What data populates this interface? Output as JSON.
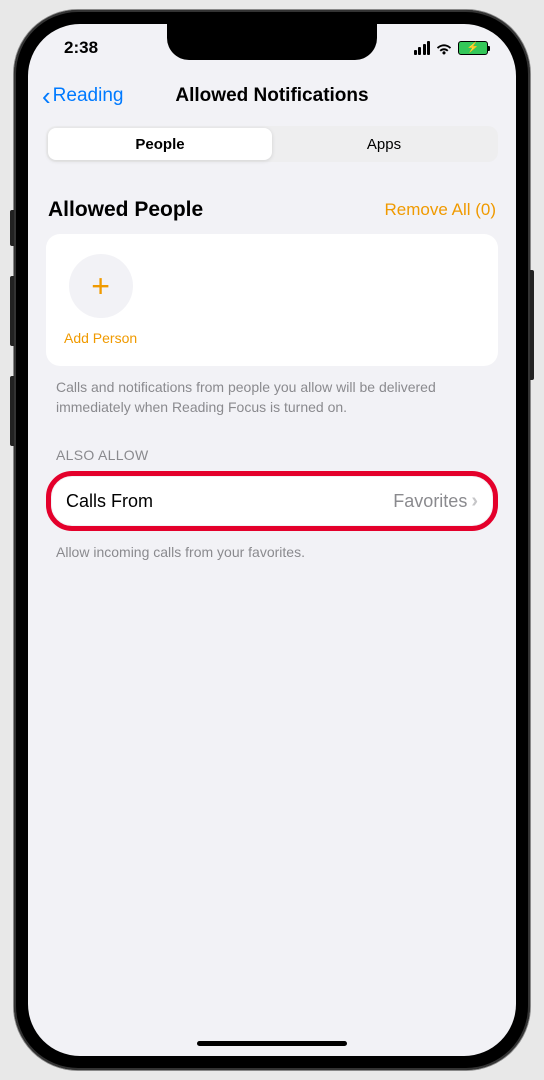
{
  "status": {
    "time": "2:38"
  },
  "nav": {
    "back_label": "Reading",
    "title": "Allowed Notifications"
  },
  "segmented": {
    "people": "People",
    "apps": "Apps"
  },
  "allowed_people": {
    "title": "Allowed People",
    "remove_all": "Remove All (0)",
    "add_label": "Add Person",
    "footer": "Calls and notifications from people you allow will be delivered immediately when Reading Focus is turned on."
  },
  "also_allow": {
    "header": "ALSO ALLOW",
    "calls_label": "Calls From",
    "calls_value": "Favorites",
    "footer": "Allow incoming calls from your favorites."
  }
}
